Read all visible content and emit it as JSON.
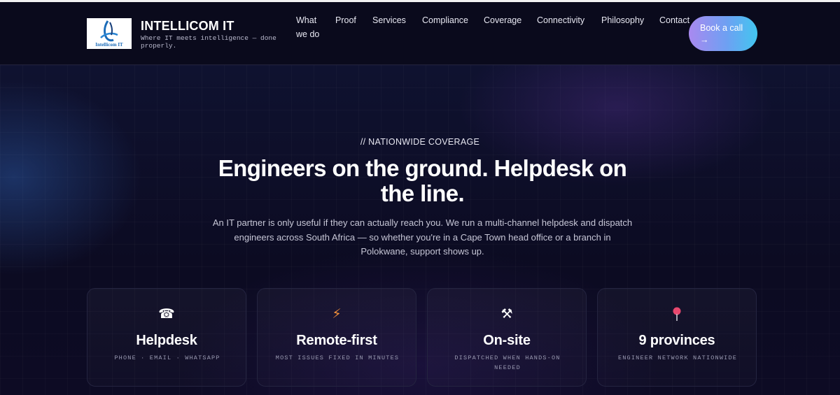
{
  "header": {
    "logo_text": "Intellicom IT",
    "brand_name": "INTELLICOM IT",
    "tagline": "Where IT meets intelligence — done properly.",
    "nav": [
      {
        "label": "What we do"
      },
      {
        "label": "Proof"
      },
      {
        "label": "Services"
      },
      {
        "label": "Compliance"
      },
      {
        "label": "Coverage"
      },
      {
        "label": "Connectivity"
      },
      {
        "label": "Philosophy"
      },
      {
        "label": "Contact"
      }
    ],
    "cta_label": "Book a call →"
  },
  "hero": {
    "eyebrow": "// NATIONWIDE COVERAGE",
    "title": "Engineers on the ground. Helpdesk on the line.",
    "body": "An IT partner is only useful if they can actually reach you. We run a multi-channel helpdesk and dispatch engineers across South Africa — so whether you're in a Cape Town head office or a branch in Polokwane, support shows up."
  },
  "cards": [
    {
      "icon": "telephone-icon",
      "glyph": "☎",
      "icon_color": "#ffffff",
      "title": "Helpdesk",
      "subtitle": "PHONE · EMAIL · WHATSAPP"
    },
    {
      "icon": "lightning-icon",
      "glyph": "⚡",
      "icon_color": "#f5913a",
      "title": "Remote-first",
      "subtitle": "MOST ISSUES FIXED IN MINUTES"
    },
    {
      "icon": "tools-icon",
      "glyph": "⚒",
      "icon_color": "#ffffff",
      "title": "On-site",
      "subtitle": "DISPATCHED WHEN HANDS-ON NEEDED"
    },
    {
      "icon": "map-pin-icon",
      "glyph": "●",
      "icon_color": "#e8486e",
      "title": "9 provinces",
      "subtitle": "ENGINEER NETWORK NATIONWIDE"
    }
  ],
  "colors": {
    "background": "#0c0b1f",
    "accent_gradient_start": "#a989f0",
    "accent_gradient_end": "#42c6f0"
  }
}
